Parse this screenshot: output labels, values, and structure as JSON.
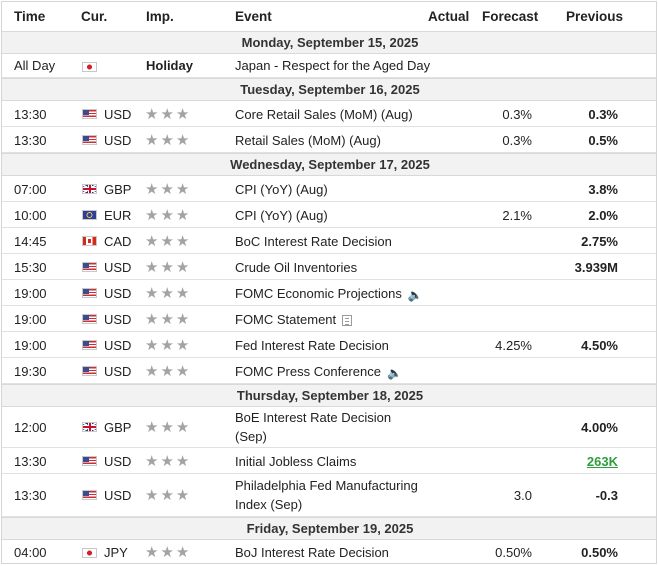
{
  "headers": {
    "time": "Time",
    "currency": "Cur.",
    "importance": "Imp.",
    "event": "Event",
    "actual": "Actual",
    "forecast": "Forecast",
    "previous": "Previous"
  },
  "stars_glyph": "★★★",
  "days": [
    {
      "label": "Monday, September 15, 2025"
    },
    {
      "label": "Tuesday, September 16, 2025"
    },
    {
      "label": "Wednesday, September 17, 2025"
    },
    {
      "label": "Thursday, September 18, 2025"
    },
    {
      "label": "Friday, September 19, 2025"
    }
  ],
  "events": [
    {
      "time": "All Day",
      "flag": "japan-flag-icon",
      "currency": "",
      "importance_text": "Holiday",
      "event": "Japan - Respect for the Aged Day",
      "actual": "",
      "forecast": "",
      "previous": ""
    },
    {
      "time": "13:30",
      "flag": "us-flag-icon",
      "currency": "USD",
      "event": "Core Retail Sales (MoM) (Aug)",
      "actual": "",
      "forecast": "0.3%",
      "previous": "0.3%"
    },
    {
      "time": "13:30",
      "flag": "us-flag-icon",
      "currency": "USD",
      "event": "Retail Sales (MoM) (Aug)",
      "actual": "",
      "forecast": "0.3%",
      "previous": "0.5%"
    },
    {
      "time": "07:00",
      "flag": "uk-flag-icon",
      "currency": "GBP",
      "event": "CPI (YoY) (Aug)",
      "actual": "",
      "forecast": "",
      "previous": "3.8%"
    },
    {
      "time": "10:00",
      "flag": "eu-flag-icon",
      "currency": "EUR",
      "event": "CPI (YoY) (Aug)",
      "actual": "",
      "forecast": "2.1%",
      "previous": "2.0%"
    },
    {
      "time": "14:45",
      "flag": "canada-flag-icon",
      "currency": "CAD",
      "event": "BoC Interest Rate Decision",
      "actual": "",
      "forecast": "",
      "previous": "2.75%"
    },
    {
      "time": "15:30",
      "flag": "us-flag-icon",
      "currency": "USD",
      "event": "Crude Oil Inventories",
      "actual": "",
      "forecast": "",
      "previous": "3.939M"
    },
    {
      "time": "19:00",
      "flag": "us-flag-icon",
      "currency": "USD",
      "event": "FOMC Economic Projections",
      "icon": "speaker-icon",
      "actual": "",
      "forecast": "",
      "previous": ""
    },
    {
      "time": "19:00",
      "flag": "us-flag-icon",
      "currency": "USD",
      "event": "FOMC Statement",
      "icon": "document-icon",
      "actual": "",
      "forecast": "",
      "previous": ""
    },
    {
      "time": "19:00",
      "flag": "us-flag-icon",
      "currency": "USD",
      "event": "Fed Interest Rate Decision",
      "actual": "",
      "forecast": "4.25%",
      "previous": "4.50%"
    },
    {
      "time": "19:30",
      "flag": "us-flag-icon",
      "currency": "USD",
      "event": "FOMC Press Conference",
      "icon": "speaker-icon",
      "actual": "",
      "forecast": "",
      "previous": ""
    },
    {
      "time": "12:00",
      "flag": "uk-flag-icon",
      "currency": "GBP",
      "event_line1": "BoE Interest Rate Decision",
      "event_line2": "(Sep)",
      "actual": "",
      "forecast": "",
      "previous": "4.00%"
    },
    {
      "time": "13:30",
      "flag": "us-flag-icon",
      "currency": "USD",
      "event": "Initial Jobless Claims",
      "actual": "",
      "forecast": "",
      "previous": "263K",
      "previous_color": "#2f9e3e"
    },
    {
      "time": "13:30",
      "flag": "us-flag-icon",
      "currency": "USD",
      "event_line1": "Philadelphia Fed Manufacturing",
      "event_line2": "Index (Sep)",
      "actual": "",
      "forecast": "3.0",
      "previous": "-0.3"
    },
    {
      "time": "04:00",
      "flag": "japan-flag-icon",
      "currency": "JPY",
      "event": "BoJ Interest Rate Decision",
      "actual": "",
      "forecast": "0.50%",
      "previous": "0.50%"
    }
  ]
}
